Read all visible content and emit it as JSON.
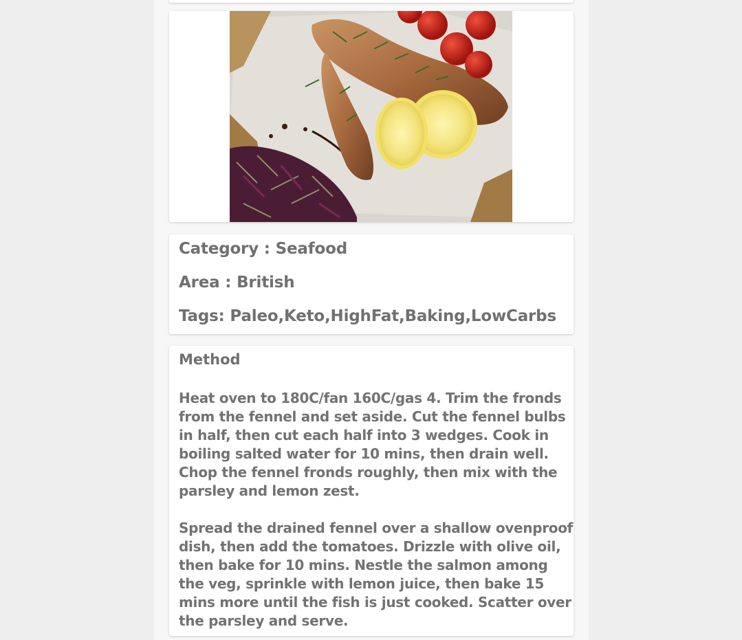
{
  "meal": {
    "image_alt": "Baked salmon with fennel & tomatoes",
    "category_text": "Category : Seafood",
    "area_text": "Area : British",
    "tags_text": "Tags: Paleo,Keto,HighFat,Baking,LowCarbs"
  },
  "method": {
    "title": "Method",
    "paragraphs": [
      "Heat oven to 180C/fan 160C/gas 4. Trim the fronds from the fennel and set aside. Cut the fennel bulbs in half, then cut each half into 3 wedges. Cook in boiling salted water for 10 mins, then drain well. Chop the fennel fronds roughly, then mix with the parsley and lemon zest.",
      "Spread the drained fennel over a shallow ovenproof dish, then add the tomatoes. Drizzle with olive oil, then bake for 10 mins. Nestle the salmon among the veg, sprinkle with lemon juice, then bake 15 mins more until the fish is just cooked. Scatter over the parsley and serve."
    ]
  }
}
